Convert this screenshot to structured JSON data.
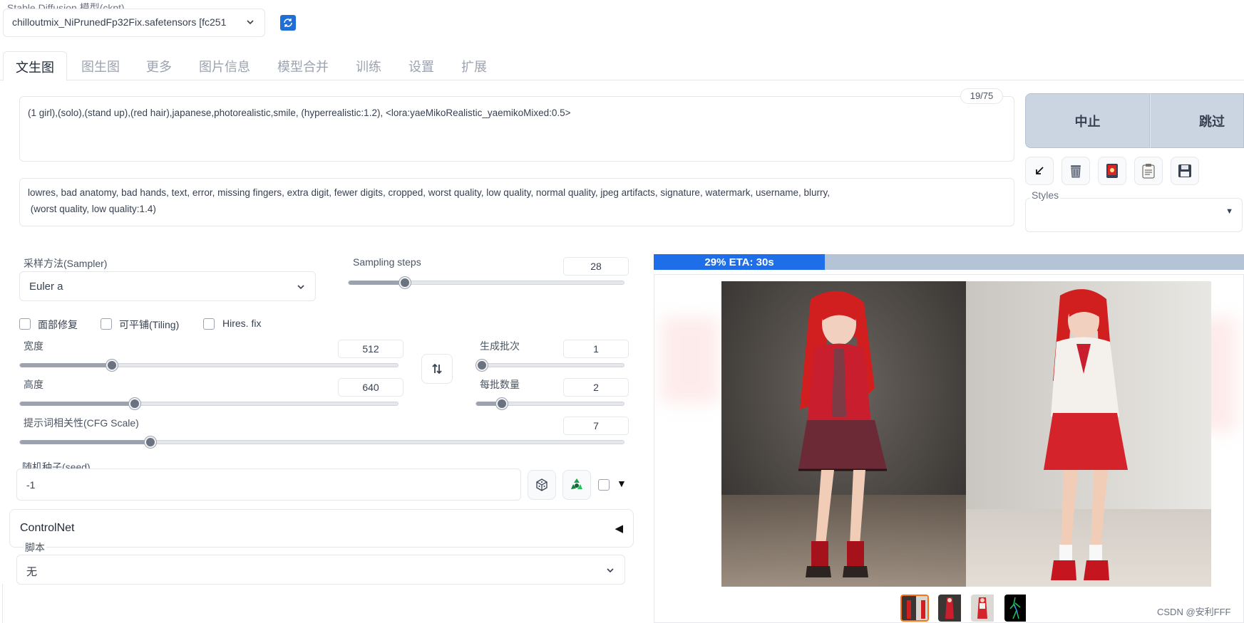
{
  "model": {
    "label": "Stable Diffusion 模型(ckpt)",
    "value": "chilloutmix_NiPrunedFp32Fix.safetensors [fc251"
  },
  "tabs": [
    "文生图",
    "图生图",
    "更多",
    "图片信息",
    "模型合并",
    "训练",
    "设置",
    "扩展"
  ],
  "prompt": {
    "text": "(1 girl),(solo),(stand up),(red hair),japanese,photorealistic,smile, (hyperrealistic:1.2), <lora:yaeMikoRealistic_yaemikoMixed:0.5>",
    "token_count": "19/75"
  },
  "negative_prompt": {
    "line1": "lowres, bad anatomy, bad hands, text, error, missing fingers, extra digit, fewer digits, cropped, worst quality, low quality, normal quality, jpeg artifacts, signature, watermark, username, blurry,",
    "line2": " (worst quality, low quality:1.4)"
  },
  "buttons": {
    "interrupt": "中止",
    "skip": "跳过"
  },
  "styles": {
    "label": "Styles"
  },
  "sampler": {
    "label": "采样方法(Sampler)",
    "value": "Euler a"
  },
  "sampling_steps": {
    "label": "Sampling steps",
    "value": "28",
    "fraction": 0.19
  },
  "checks": {
    "face": "面部修复",
    "tiling": "可平铺(Tiling)",
    "hires": "Hires. fix"
  },
  "width": {
    "label": "宽度",
    "value": "512",
    "fraction": 0.235
  },
  "height": {
    "label": "高度",
    "value": "640",
    "fraction": 0.297
  },
  "batch_count": {
    "label": "生成批次",
    "value": "1",
    "fraction": 0.0
  },
  "batch_size": {
    "label": "每批数量",
    "value": "2",
    "fraction": 0.143
  },
  "cfg": {
    "label": "提示词相关性(CFG Scale)",
    "value": "7",
    "fraction": 0.21
  },
  "seed": {
    "label": "随机种子(seed)",
    "value": "-1"
  },
  "controlnet": {
    "label": "ControlNet",
    "arrow": "◀"
  },
  "script": {
    "label": "脚本",
    "value": "无"
  },
  "progress": {
    "text": "29% ETA: 30s",
    "fraction": 0.29
  },
  "watermark": "CSDN @安利FFF",
  "colors": {
    "progress": "#1d6ee8",
    "progress_bg": "#b4c3d6",
    "tab_active": "#1f2937",
    "hair": "#d11f1f"
  }
}
